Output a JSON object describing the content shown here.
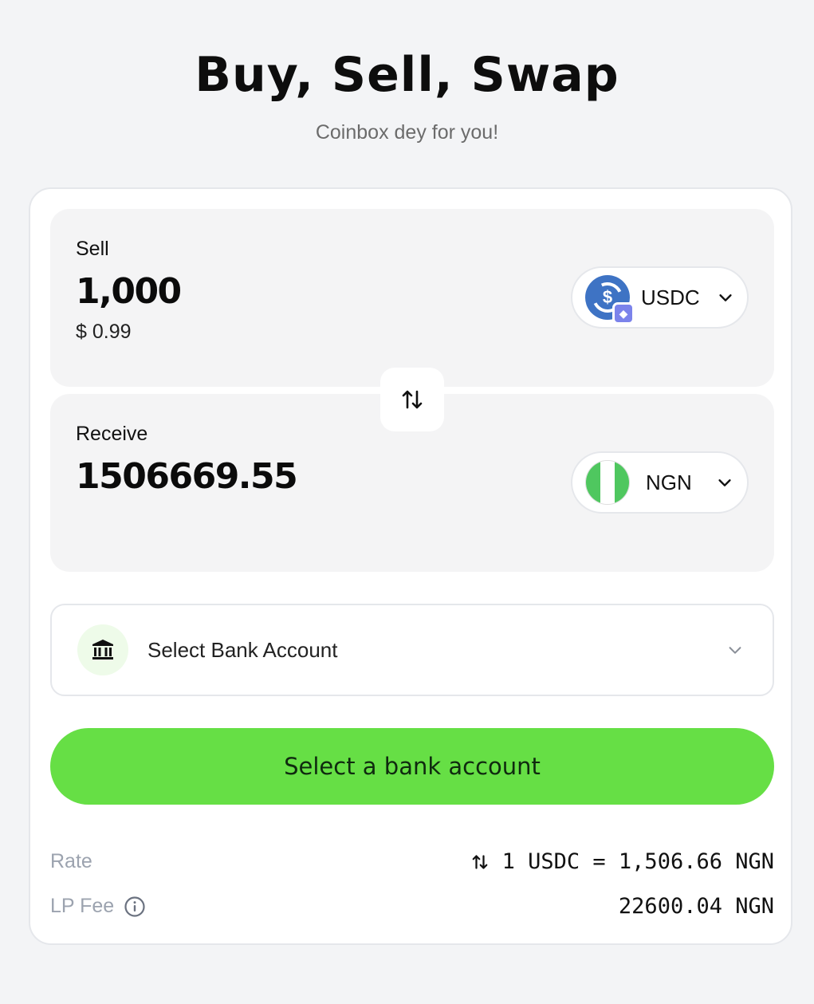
{
  "header": {
    "title": "Buy, Sell, Swap",
    "subtitle": "Coinbox dey for you!"
  },
  "sell": {
    "label": "Sell",
    "amount": "1,000",
    "usd_value": "$ 0.99",
    "token": "USDC",
    "token_icon": "usdc-icon",
    "network_badge": "ethereum-icon"
  },
  "receive": {
    "label": "Receive",
    "amount": "1506669.55",
    "token": "NGN",
    "token_icon": "nigeria-flag-icon"
  },
  "bank": {
    "label": "Select Bank Account",
    "icon": "bank-icon"
  },
  "cta": {
    "label": "Select a bank account",
    "color": "#66df45"
  },
  "info": {
    "rate_label": "Rate",
    "rate_value": "1 USDC = 1,506.66 NGN",
    "fee_label": "LP Fee",
    "fee_value": "22600.04 NGN"
  },
  "colors": {
    "accent": "#66df45",
    "usdc": "#3e73c4",
    "nigeria_green": "#4fc75f"
  }
}
